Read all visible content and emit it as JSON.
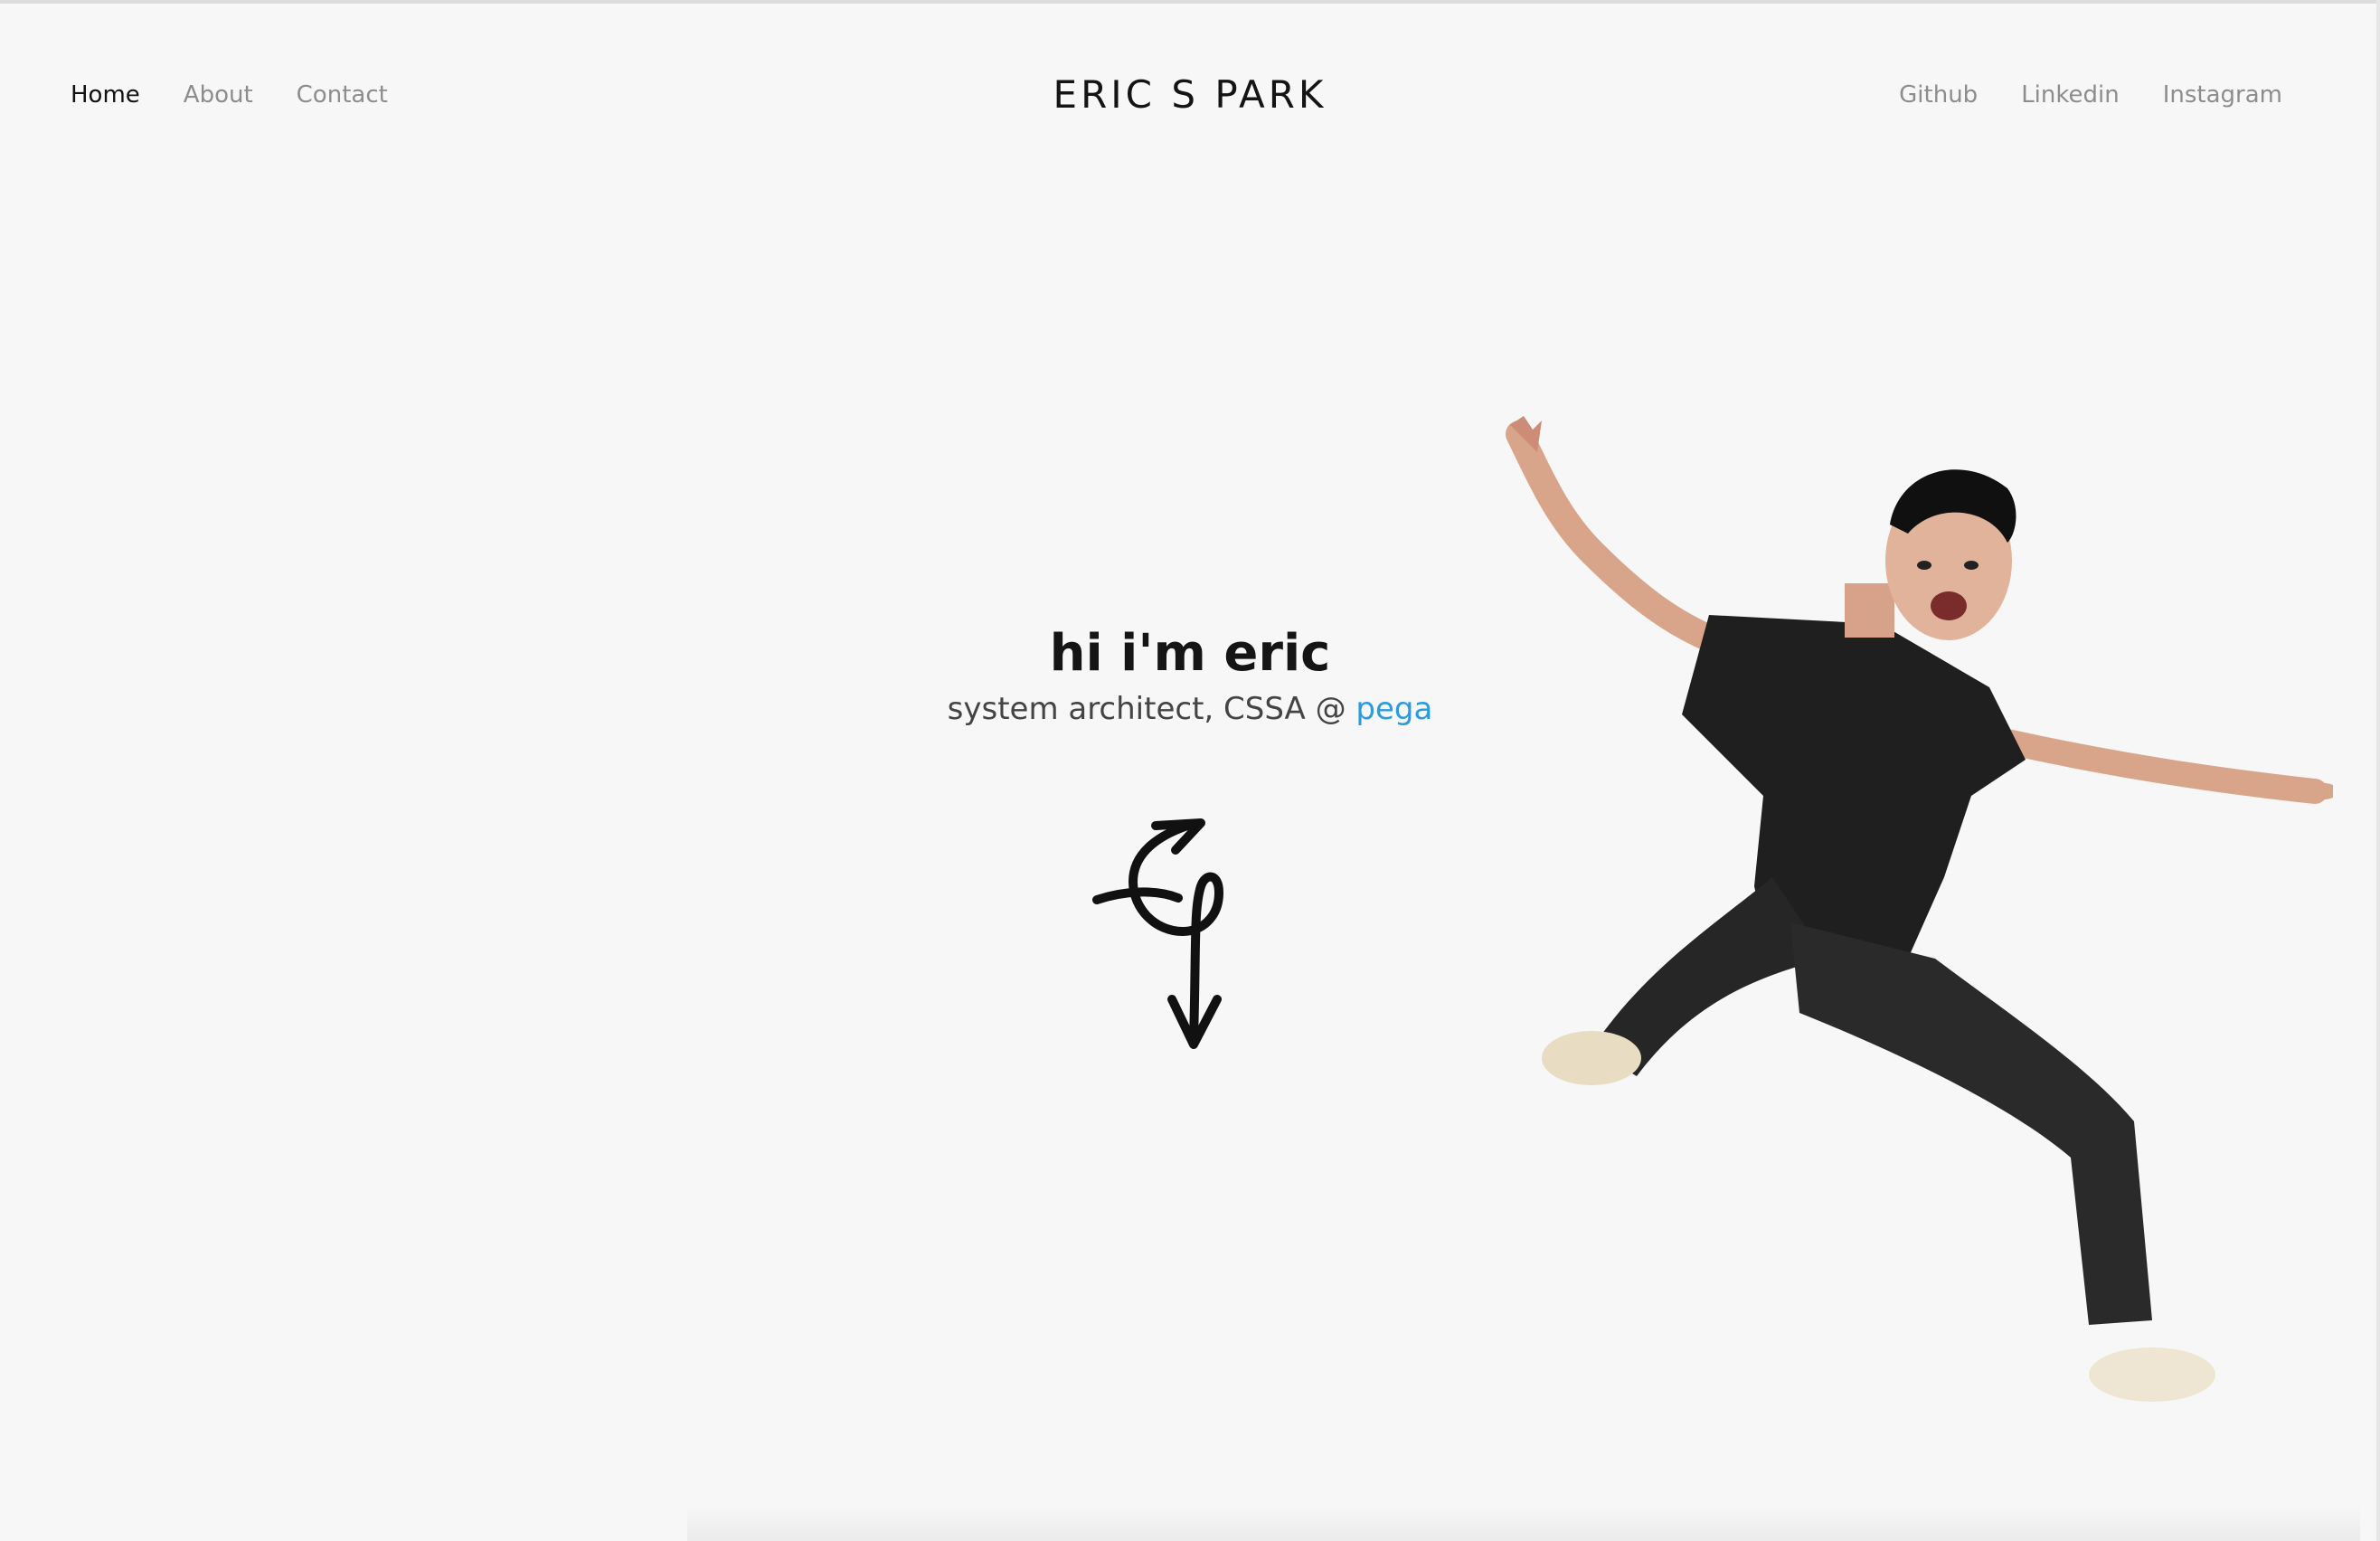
{
  "nav": {
    "left": [
      {
        "label": "Home",
        "active": true
      },
      {
        "label": "About",
        "active": false
      },
      {
        "label": "Contact",
        "active": false
      }
    ],
    "right": [
      {
        "label": "Github"
      },
      {
        "label": "Linkedin"
      },
      {
        "label": "Instagram"
      }
    ]
  },
  "brand": {
    "title": "ERIC S PARK"
  },
  "hero": {
    "title": "hi i'm eric",
    "subtitle_prefix": "system architect, CSSA @ ",
    "subtitle_link": "pega"
  },
  "colors": {
    "background": "#f7f7f7",
    "text_dark": "#151515",
    "nav_inactive": "#8d8d8d",
    "link_accent": "#2b9be0"
  },
  "icons": {
    "monogram": "es-monogram-arrow-down-icon",
    "photo": "jumping-person-photo"
  }
}
